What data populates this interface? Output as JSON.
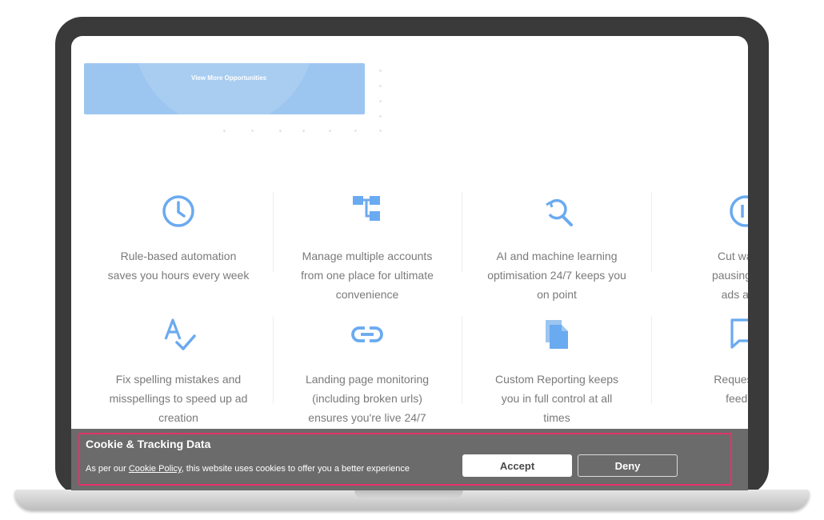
{
  "opportunities": {
    "link_label": "View More Opportunities"
  },
  "features": [
    {
      "icon": "clock-icon",
      "text_lines": [
        "Rule-based automation",
        "saves you hours every week"
      ]
    },
    {
      "icon": "hierarchy-icon",
      "text_lines": [
        "Manage multiple accounts",
        "from one place for ultimate",
        "convenience"
      ]
    },
    {
      "icon": "search-refresh-icon",
      "text_lines": [
        "AI and machine learning",
        "optimisation 24/7 keeps you",
        "on point"
      ]
    },
    {
      "icon": "pause-icon",
      "text_lines": [
        "Cut wasted",
        "pausing unde",
        "ads and k"
      ]
    },
    {
      "icon": "spellcheck-icon",
      "text_lines": [
        "Fix spelling mistakes and",
        "misspellings to speed up ad",
        "creation"
      ]
    },
    {
      "icon": "link-icon",
      "text_lines": [
        "Landing page monitoring",
        "(including broken urls)",
        "ensures you're live 24/7"
      ]
    },
    {
      "icon": "document-icon",
      "text_lines": [
        "Custom Reporting keeps",
        "you in full control at all",
        "times"
      ]
    },
    {
      "icon": "chat-icon",
      "text_lines": [
        "Request feat",
        "feedbac"
      ]
    }
  ],
  "cookie_banner": {
    "title": "Cookie & Tracking Data",
    "message_prefix": "As per our ",
    "policy_link": "Cookie Policy",
    "message_suffix": ", this website uses cookies to offer you a better experience",
    "accept_label": "Accept",
    "deny_label": "Deny"
  },
  "colors": {
    "accent_blue": "#9cc6f0",
    "icon_blue": "#6aaaf0",
    "banner_bg": "#6b6b6b",
    "highlight_outline": "#e5326b"
  }
}
